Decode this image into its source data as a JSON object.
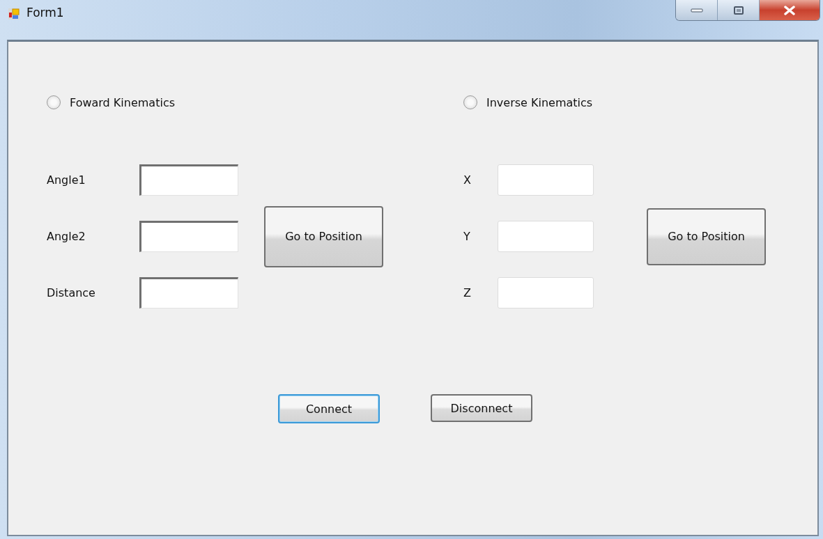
{
  "window": {
    "title": "Form1"
  },
  "sections": [
    {
      "radio": {
        "label": "Foward Kinematics",
        "selected": false
      },
      "fields": [
        {
          "label": "Angle1"
        },
        {
          "label": "Angle2"
        },
        {
          "label": "Distance"
        }
      ],
      "button": "Go to Position"
    },
    {
      "radio": {
        "label": "Inverse Kinematics",
        "selected": false
      },
      "fields": [
        {
          "label": "X"
        },
        {
          "label": "Y"
        },
        {
          "label": "Z"
        }
      ],
      "button": "Go to Position"
    }
  ],
  "buttons": [
    {
      "label": "Connect",
      "focused": true
    },
    {
      "label": "Disconnect",
      "focused": false
    }
  ]
}
